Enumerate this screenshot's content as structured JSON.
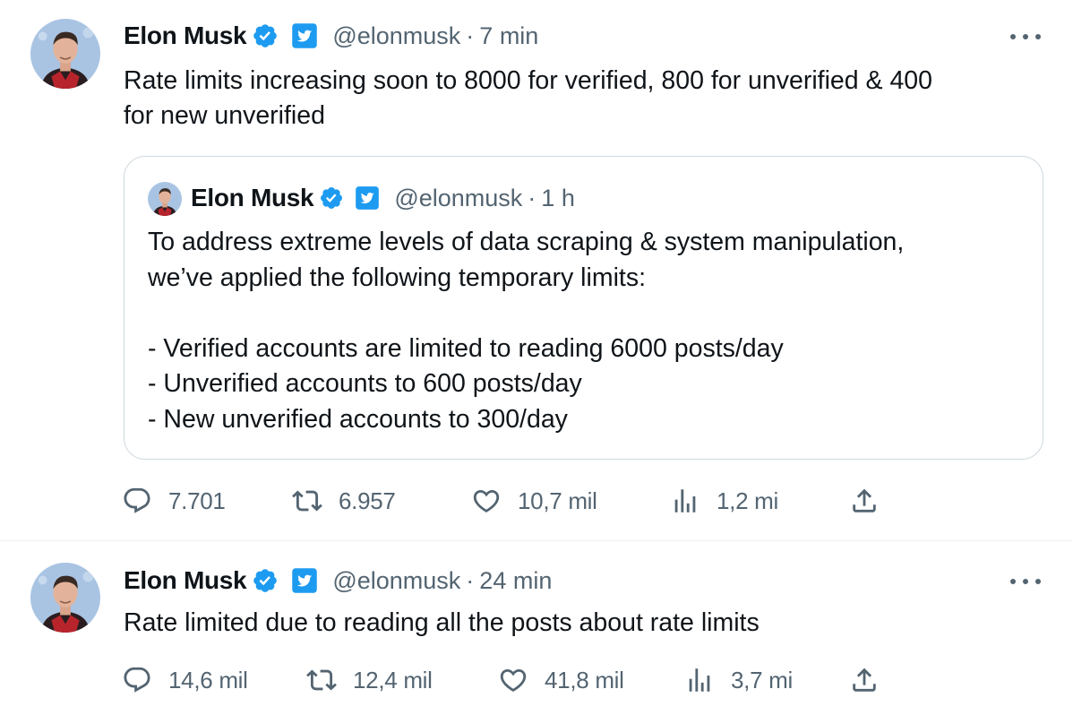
{
  "tweets": [
    {
      "author": {
        "name": "Elon Musk",
        "handle": "@elonmusk",
        "verified_icon": "verified-badge-icon",
        "affiliate_icon": "twitter-logo-icon"
      },
      "time_separator": "·",
      "time": "7 min",
      "text": "Rate limits increasing soon to 8000 for verified, 800 for unverified & 400\nfor new unverified",
      "quote": {
        "author": {
          "name": "Elon Musk",
          "handle": "@elonmusk"
        },
        "time_separator": "·",
        "time": "1 h",
        "text": "To address extreme levels of data scraping & system manipulation,\nwe’ve applied the following temporary limits:\n\n- Verified accounts are limited to reading 6000 posts/day\n- Unverified accounts to 600 posts/day\n- New unverified accounts to 300/day"
      },
      "actions": {
        "replies": "7.701",
        "reposts": "6.957",
        "likes": "10,7 mil",
        "views": "1,2 mi"
      }
    },
    {
      "author": {
        "name": "Elon Musk",
        "handle": "@elonmusk",
        "verified_icon": "verified-badge-icon",
        "affiliate_icon": "twitter-logo-icon"
      },
      "time_separator": "·",
      "time": "24 min",
      "text": "Rate limited due to reading all the posts about rate limits",
      "actions": {
        "replies": "14,6 mil",
        "reposts": "12,4 mil",
        "likes": "41,8 mil",
        "views": "3,7 mi"
      }
    }
  ],
  "colors": {
    "verified_blue": "#1d9bf0",
    "muted_text": "#536471",
    "primary_text": "#0f1419",
    "border": "#cfd9de"
  }
}
